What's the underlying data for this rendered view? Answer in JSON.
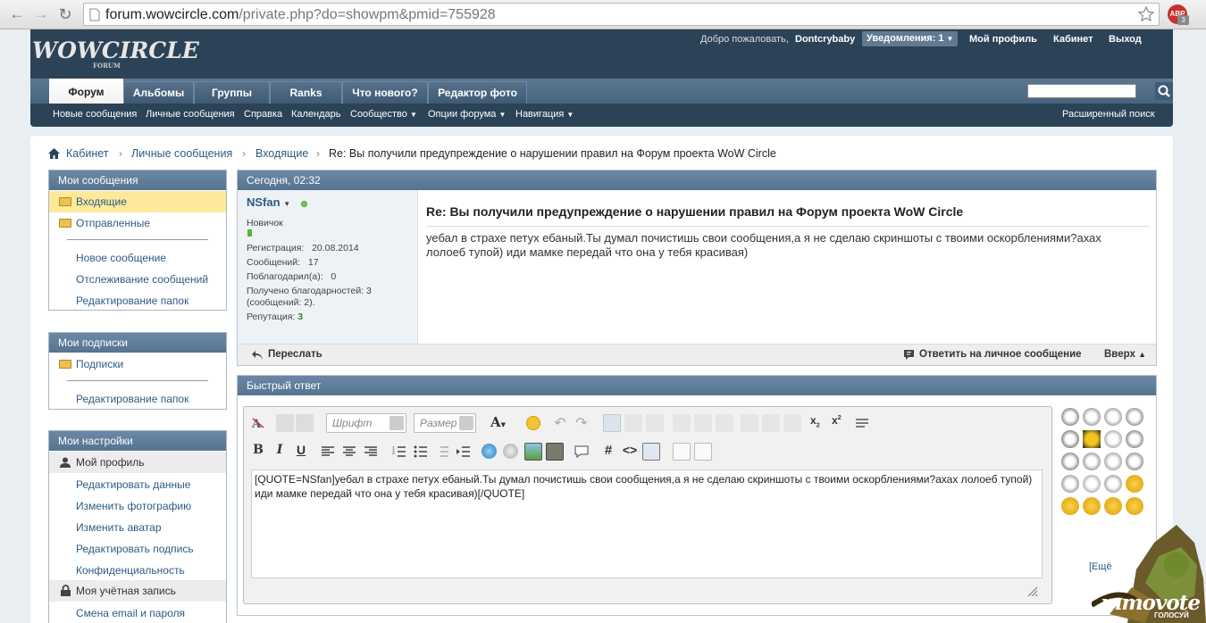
{
  "browser": {
    "url_host": "forum.wowcircle.com",
    "url_path": "/private.php?do=showpm&pmid=755928",
    "abp": "ABP",
    "abp_count": "3"
  },
  "header": {
    "logo": "WOWCIRCLE",
    "logo_sub": "FORUM",
    "welcome": "Добро пожаловать,",
    "username": "Dontcrybaby",
    "notifications": "Уведомления: 1",
    "profile": "Мой профиль",
    "cabinet": "Кабинет",
    "logout": "Выход"
  },
  "tabs": [
    "Форум",
    "Альбомы",
    "Группы",
    "Ranks",
    "Что нового?",
    "Редактор фото"
  ],
  "subnav": {
    "items": [
      "Новые сообщения",
      "Личные сообщения",
      "Справка",
      "Календарь",
      "Сообщество",
      "Опции форума",
      "Навигация"
    ],
    "advanced_search": "Расширенный поиск"
  },
  "breadcrumb": [
    "Кабинет",
    "Личные сообщения",
    "Входящие",
    "Re: Вы получили предупреждение о нарушении правил на Форум проекта WoW Circle"
  ],
  "sidebar": {
    "messages": {
      "title": "Мои сообщения",
      "inbox": "Входящие",
      "sent": "Отправленные",
      "new": "Новое сообщение",
      "track": "Отслеживание сообщений",
      "edit_folders": "Редактирование папок"
    },
    "subscriptions": {
      "title": "Мои подписки",
      "subs": "Подписки",
      "edit_folders": "Редактирование папок"
    },
    "settings": {
      "title": "Мои настройки",
      "profile": "Мой профиль",
      "edit_data": "Редактировать данные",
      "change_photo": "Изменить фотографию",
      "change_avatar": "Изменить аватар",
      "edit_signature": "Редактировать подпись",
      "privacy": "Конфиденциальность",
      "account": "Моя учётная запись",
      "change_email": "Смена email и пароля"
    }
  },
  "message": {
    "date": "Сегодня, 02:32",
    "author": "NSfan",
    "rank": "Новичок",
    "reg_label": "Регистрация:",
    "reg_value": "20.08.2014",
    "posts_label": "Сообщений:",
    "posts_value": "17",
    "thanked_label": "Поблагодарил(а):",
    "thanked_value": "0",
    "received_line1": "Получено благодарностей: 3",
    "received_line2": "(сообщений: 2).",
    "rep_label": "Репутация:",
    "rep_value": "3",
    "title": "Re: Вы получили предупреждение о нарушении правил на Форум проекта WoW Circle",
    "body": "уебал в страхе петух ебаный.Ты думал почистишь свои сообщения,а я не сделаю скриншоты с твоими оскорблениями?ахах лолоеб тупой) иди мамке передай что она у тебя красивая)",
    "forward": "Переслать",
    "reply": "Ответить на личное сообщение",
    "top": "Вверх"
  },
  "quick_reply": {
    "title": "Быстрый ответ",
    "font_placeholder": "Шрифт",
    "size_placeholder": "Размер",
    "text": "[QUOTE=NSfan]уебал в страхе петух ебаный.Ты думал почистишь свои сообщения,а я не сделаю скриншоты с твоими оскорблениями?ахах лолоеб тупой) иди мамке передай что она у тебя красивая)[/QUOTE]",
    "more_smilies": "[Ещё"
  },
  "promo": {
    "brand": "mmovote",
    "sub": "ГОЛОСУЙ"
  },
  "colors": {
    "header_bg": "#2b4257",
    "tab_bg": "#56738f",
    "link": "#2f5a84",
    "highlight": "#fde99a"
  }
}
